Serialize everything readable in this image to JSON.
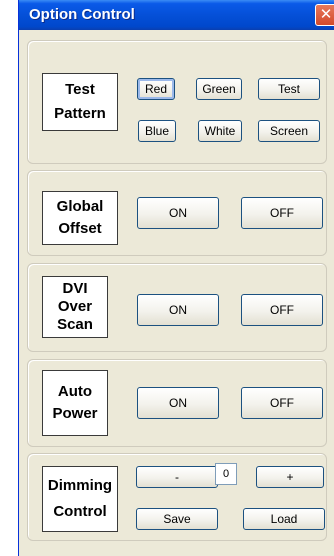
{
  "window": {
    "title": "Option Control",
    "close_glyph": "✕"
  },
  "test_pattern": {
    "label_line1": "Test",
    "label_line2": "Pattern",
    "buttons": [
      "Red",
      "Green",
      "Test",
      "Blue",
      "White",
      "Screen"
    ]
  },
  "global_offset": {
    "label_line1": "Global",
    "label_line2": "Offset",
    "on_label": "ON",
    "off_label": "OFF"
  },
  "dvi_over_scan": {
    "label_line1": "DVI",
    "label_line2": "Over",
    "label_line3": "Scan",
    "on_label": "ON",
    "off_label": "OFF"
  },
  "auto_power": {
    "label_line1": "Auto",
    "label_line2": "Power",
    "on_label": "ON",
    "off_label": "OFF"
  },
  "dimming": {
    "label_line1": "Dimming",
    "label_line2": "Control",
    "minus_label": "-",
    "value": "0",
    "plus_label": "+",
    "save_label": "Save",
    "load_label": "Load"
  }
}
